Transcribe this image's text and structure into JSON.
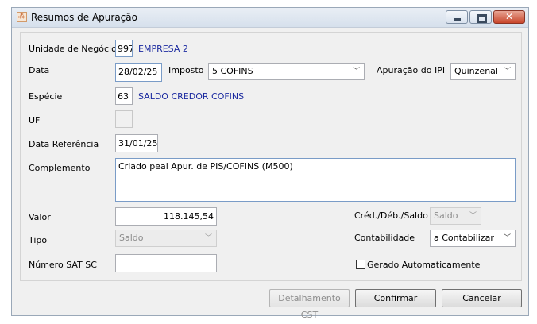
{
  "window": {
    "title": "Resumos de Apuração",
    "icon": "app-grid-icon"
  },
  "form": {
    "unidade": {
      "label": "Unidade de Negócio",
      "code": "997",
      "name": "EMPRESA 2"
    },
    "data": {
      "label": "Data",
      "value": "28/02/25"
    },
    "imposto": {
      "label": "Imposto",
      "value": "5 COFINS"
    },
    "apuracao_ipi": {
      "label": "Apuração do IPI",
      "value": "Quinzenal"
    },
    "especie": {
      "label": "Espécie",
      "code": "63",
      "name": "SALDO CREDOR COFINS"
    },
    "uf": {
      "label": "UF",
      "value": ""
    },
    "data_referencia": {
      "label": "Data Referência",
      "value": "31/01/25"
    },
    "complemento": {
      "label": "Complemento",
      "value": "Criado peal Apur. de PIS/COFINS (M500)"
    },
    "valor": {
      "label": "Valor",
      "value": "118.145,54"
    },
    "cred_deb_saldo": {
      "label": "Créd./Déb./Saldo",
      "value": "Saldo"
    },
    "tipo": {
      "label": "Tipo",
      "value": "Saldo"
    },
    "contabilidade": {
      "label": "Contabilidade",
      "value": "a Contabilizar"
    },
    "numero_sat": {
      "label": "Número SAT SC",
      "value": ""
    },
    "gerado": {
      "label": "Gerado Automaticamente",
      "checked": false
    }
  },
  "buttons": {
    "detalhamento": "Detalhamento CST",
    "confirmar": "Confirmar",
    "cancelar": "Cancelar"
  }
}
